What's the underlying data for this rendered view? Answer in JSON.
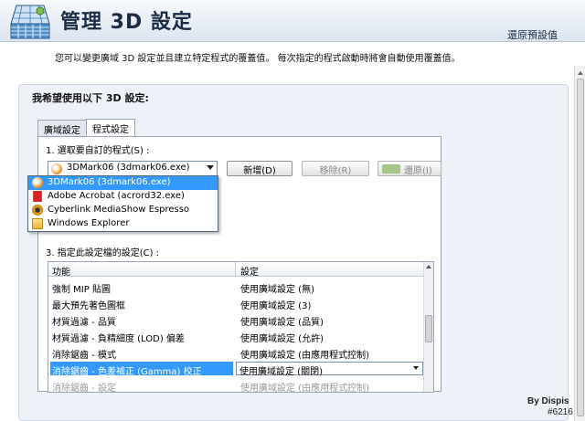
{
  "header": {
    "title": "管理 3D 設定",
    "restore_defaults": "還原預設值"
  },
  "description": "您可以變更廣域 3D 設定並且建立特定程式的覆蓋值。 每次指定的程式啟動時將會自動使用覆蓋值。",
  "panel": {
    "heading": "我希望使用以下 3D 設定:"
  },
  "tabs": [
    {
      "label": "廣域設定"
    },
    {
      "label": "程式設定"
    }
  ],
  "program": {
    "step1_label": "1. 選取要自訂的程式(S) :",
    "selected": "3DMark06 (3dmark06.exe)",
    "buttons": {
      "add": "新增(D)",
      "remove": "移除(R)",
      "restore": "還原(I)"
    },
    "dropdown_items": [
      {
        "label": "3DMark06 (3dmark06.exe)",
        "icon": "3dmark-icon"
      },
      {
        "label": "Adobe Acrobat (acrord32.exe)",
        "icon": "acrobat-icon"
      },
      {
        "label": "Cyberlink MediaShow Espresso",
        "icon": "cyberlink-icon"
      },
      {
        "label": "Windows Explorer",
        "icon": "folder-icon"
      }
    ]
  },
  "settings": {
    "step3_label": "3. 指定此設定檔的設定(C) :",
    "columns": {
      "feature": "功能",
      "setting": "設定"
    },
    "rows": [
      {
        "feature": "強制 MIP 貼圖",
        "setting": "使用廣域設定 (無)"
      },
      {
        "feature": "最大預先著色圖框",
        "setting": "使用廣域設定 (3)"
      },
      {
        "feature": "材質過濾 - 品質",
        "setting": "使用廣域設定 (品質)"
      },
      {
        "feature": "材質過濾 - 負精細度 (LOD) 偏差",
        "setting": "使用廣域設定 (允許)"
      },
      {
        "feature": "消除鋸齒 - 模式",
        "setting": "使用廣域設定 (由應用程式控制)"
      },
      {
        "feature": "消除鋸齒 - 色差補正 (Gamma) 校正",
        "setting": "使用廣域設定 (關閉)"
      },
      {
        "feature": "消除鋸齒 - 設定",
        "setting": "使用廣域設定 (由應用程式控制)"
      }
    ]
  },
  "footer": {
    "credit": "By Dispis",
    "watermark": "#6216"
  }
}
